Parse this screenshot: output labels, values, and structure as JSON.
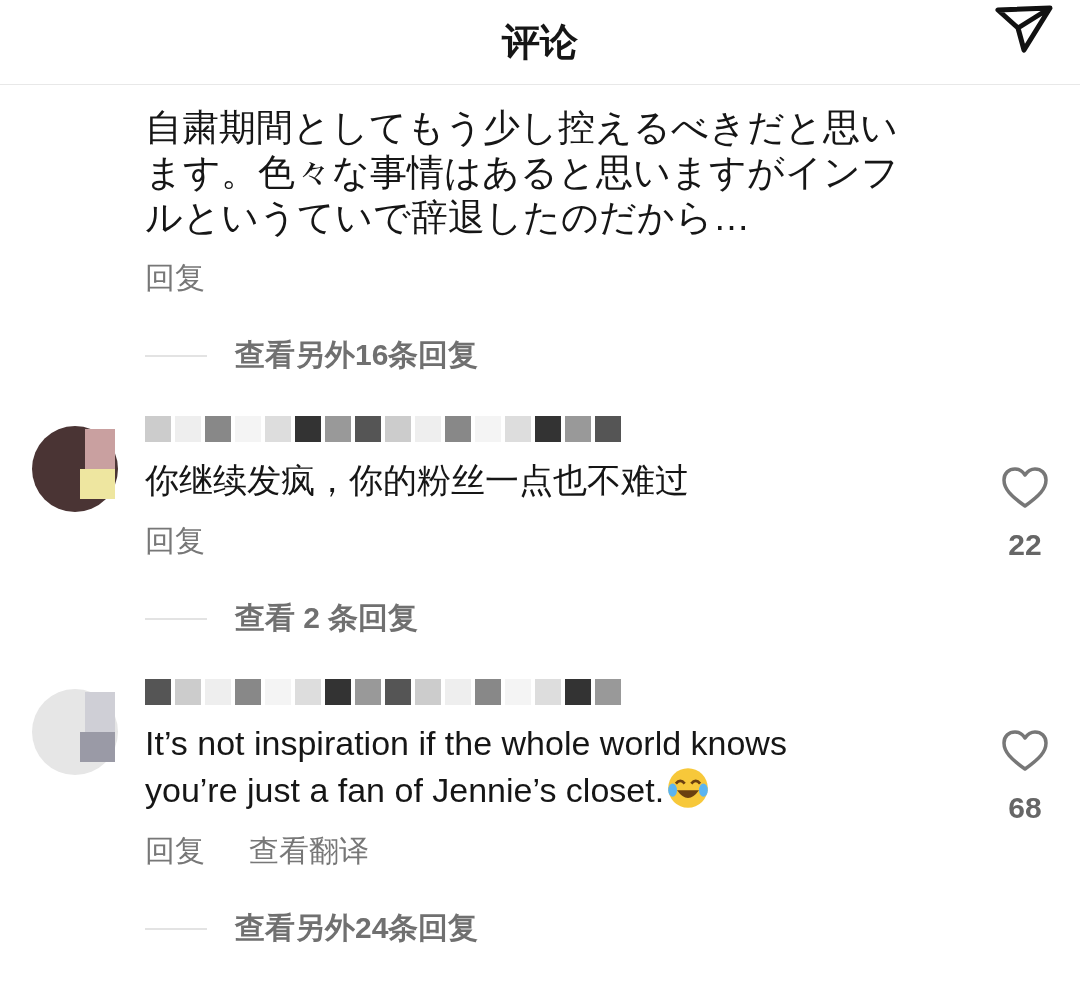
{
  "header": {
    "title": "评论"
  },
  "comments": [
    {
      "kind": "continued",
      "lines": [
        "自粛期間としてもう少し控えるべきだと思い",
        "ます。色々な事情はあると思いますがインフ",
        "ルというていで辞退したのだから…"
      ],
      "actions": [
        "回复"
      ],
      "more_replies": "查看另外16条回复"
    },
    {
      "kind": "full",
      "lines": [
        "你继续发疯，你的粉丝一点也不难过"
      ],
      "emoji": false,
      "actions": [
        "回复"
      ],
      "likes": "22",
      "more_replies": "查看 2 条回复"
    },
    {
      "kind": "full",
      "lines": [
        "It’s not inspiration if the whole world knows",
        "you’re just a fan of Jennie’s closet."
      ],
      "emoji": true,
      "actions": [
        "回复",
        "查看翻译"
      ],
      "likes": "68",
      "more_replies": "查看另外24条回复"
    }
  ]
}
